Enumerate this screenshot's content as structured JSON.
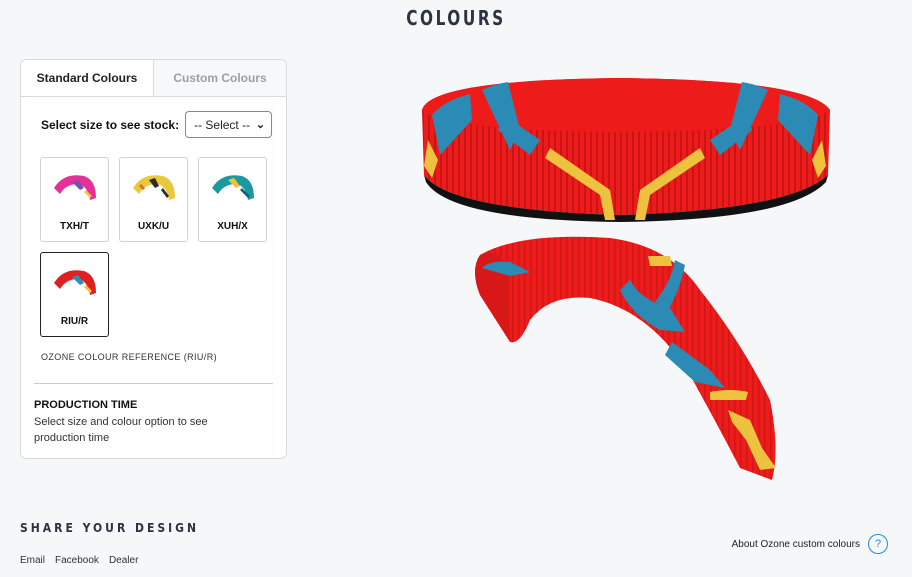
{
  "page": {
    "title": "COLOURS"
  },
  "tabs": [
    {
      "label": "Standard Colours",
      "active": true
    },
    {
      "label": "Custom Colours",
      "active": false
    }
  ],
  "size_select": {
    "label": "Select size to see stock:",
    "value": "-- Select --"
  },
  "swatches": [
    {
      "code": "TXH/T",
      "colors": {
        "base": "#e3309a",
        "accent1": "#7b4fb0",
        "accent2": "#f3c43a"
      }
    },
    {
      "code": "UXK/U",
      "colors": {
        "base": "#e9c83a",
        "accent1": "#2c2c2c",
        "accent2": "#e06a2a"
      }
    },
    {
      "code": "XUH/X",
      "colors": {
        "base": "#1a9aa0",
        "accent1": "#f0c23a",
        "accent2": "#145f7a"
      }
    },
    {
      "code": "RIU/R",
      "colors": {
        "base": "#e02020",
        "accent1": "#2a8fb8",
        "accent2": "#f0c53a"
      },
      "selected": true
    }
  ],
  "colour_reference": "OZONE COLOUR REFERENCE (RIU/R)",
  "production": {
    "title": "PRODUCTION TIME",
    "text": "Select size and colour option to see production time"
  },
  "share": {
    "title": "SHARE YOUR DESIGN",
    "links": [
      "Email",
      "Facebook",
      "Dealer"
    ]
  },
  "about": {
    "label": "About Ozone custom colours",
    "icon": "question-icon",
    "icon_glyph": "?"
  },
  "preview_colors": {
    "red": "#ee1b1b",
    "blue": "#2b8bb5",
    "yellow": "#ecc23e"
  }
}
